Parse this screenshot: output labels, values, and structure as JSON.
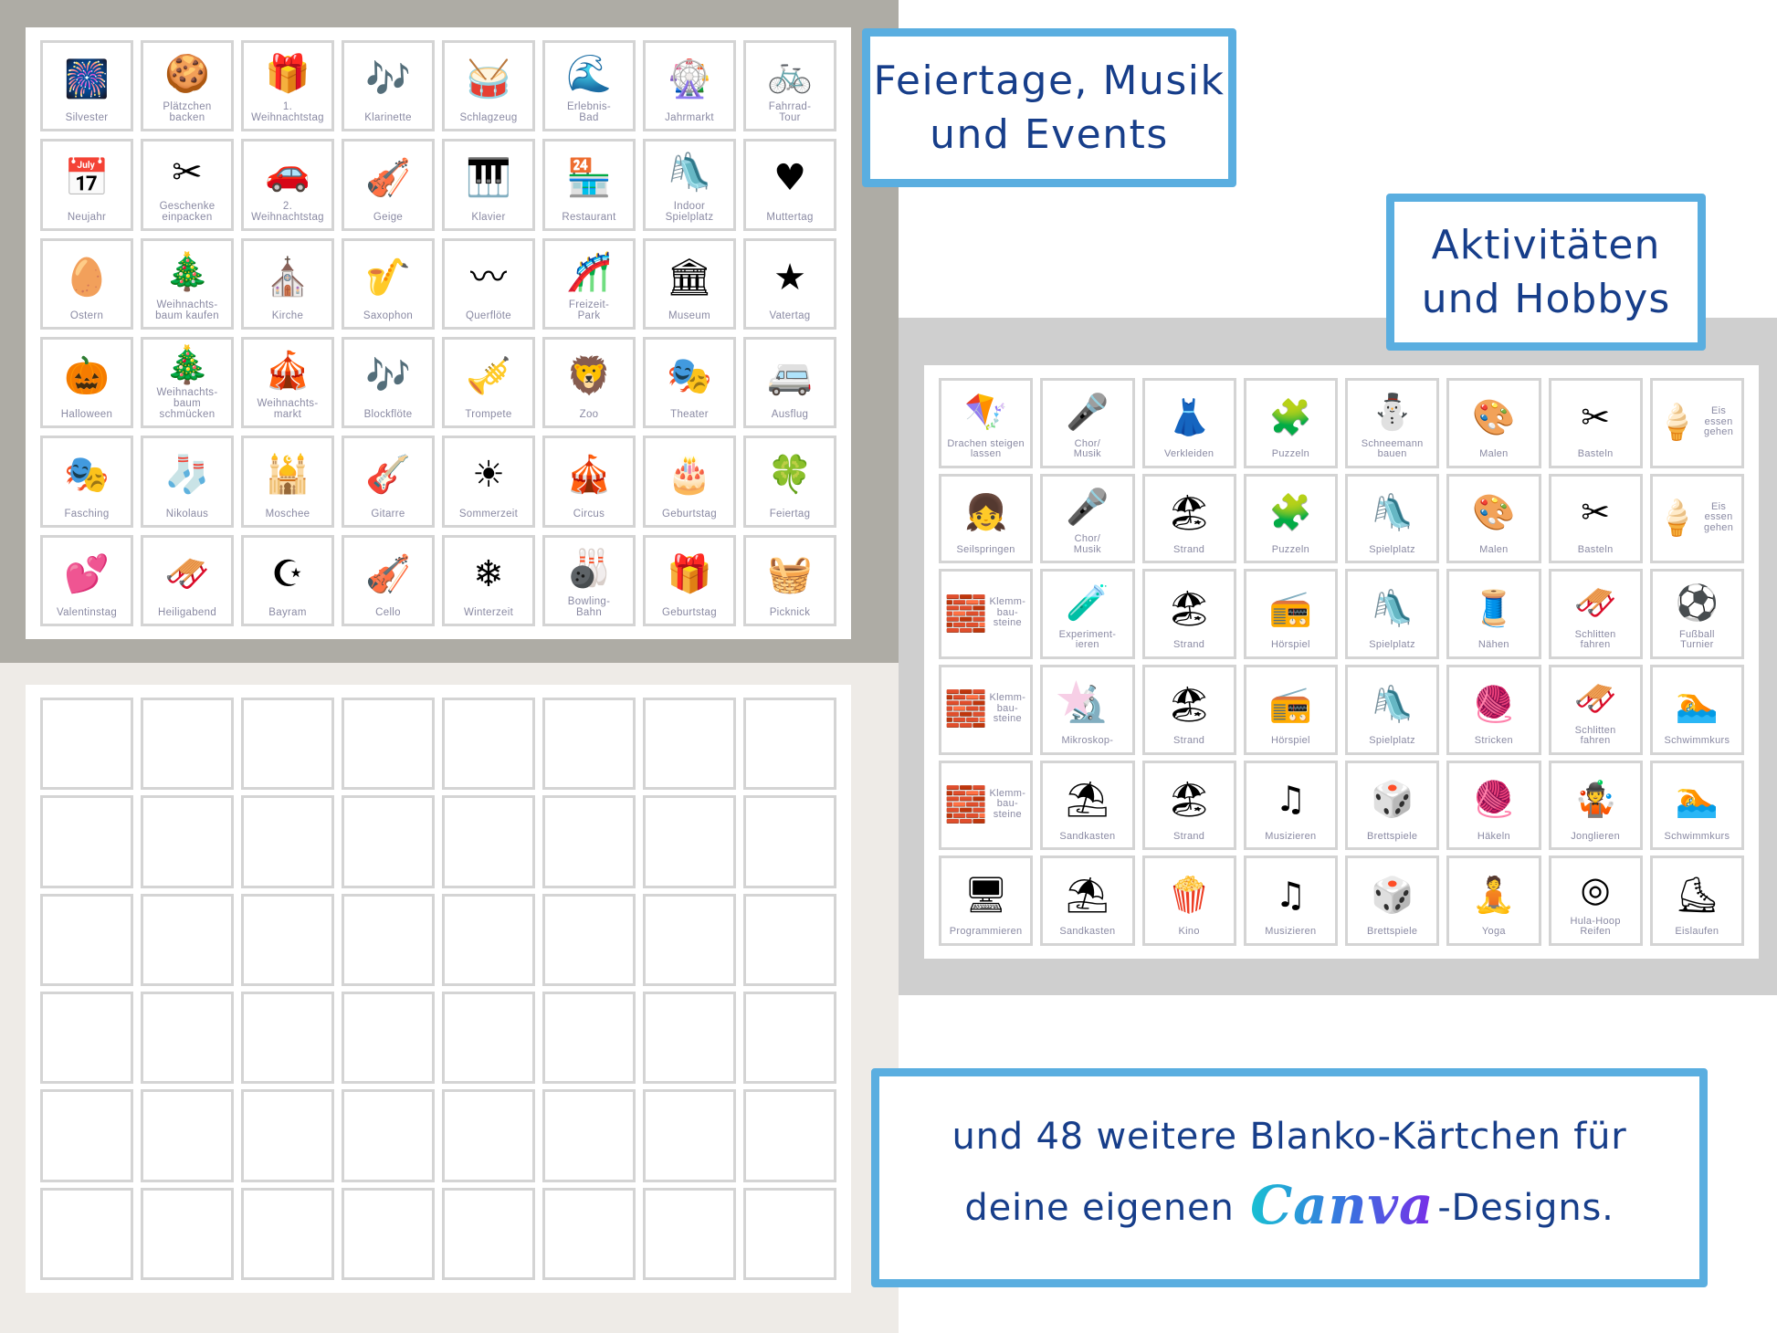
{
  "headings": {
    "events": "Feiertage, Musik\nund Events",
    "activities": "Aktivitäten\nund Hobbys",
    "blank_line1": "und 48 weitere Blanko-Kärtchen für",
    "blank_line2_pre": "deine eigenen ",
    "blank_brand": "Canva",
    "blank_line2_post": "-Designs."
  },
  "colors": {
    "frame_blue": "#5aaee0",
    "heading_navy": "#173e8a",
    "label_gray": "#8a8aa3"
  },
  "events_cards": [
    {
      "label": "Silvester",
      "icon": "fireworks",
      "glyph": "🎆"
    },
    {
      "label": "Plätzchen\nbacken",
      "icon": "cookie-dough",
      "glyph": "🍪"
    },
    {
      "label": "1.\nWeihnachtstag",
      "icon": "gifts",
      "glyph": "🎁"
    },
    {
      "label": "Klarinette",
      "icon": "clarinet",
      "glyph": "🎶"
    },
    {
      "label": "Schlagzeug",
      "icon": "drum-kit",
      "glyph": "🥁"
    },
    {
      "label": "Erlebnis-\nBad",
      "icon": "water-slide",
      "glyph": "🌊"
    },
    {
      "label": "Jahrmarkt",
      "icon": "ferris-wheel",
      "glyph": "🎡"
    },
    {
      "label": "Fahrrad-\nTour",
      "icon": "tandem-bike",
      "glyph": "🚲"
    },
    {
      "label": "Neujahr",
      "icon": "calendar",
      "glyph": "📅"
    },
    {
      "label": "Geschenke\neinpacken",
      "icon": "scissors-ribbon",
      "glyph": "✂"
    },
    {
      "label": "2.\nWeihnachtstag",
      "icon": "car-gifts",
      "glyph": "🚗"
    },
    {
      "label": "Geige",
      "icon": "violin",
      "glyph": "🎻"
    },
    {
      "label": "Klavier",
      "icon": "piano",
      "glyph": "🎹"
    },
    {
      "label": "Restaurant",
      "icon": "restaurant",
      "glyph": "🏪"
    },
    {
      "label": "Indoor\nSpielplatz",
      "icon": "playground-slide",
      "glyph": "🛝"
    },
    {
      "label": "Muttertag",
      "icon": "best-mom",
      "glyph": "♥"
    },
    {
      "label": "Ostern",
      "icon": "easter-eggs",
      "glyph": "🥚"
    },
    {
      "label": "Weihnachts-\nbaum kaufen",
      "icon": "christmas-tree",
      "glyph": "🎄"
    },
    {
      "label": "Kirche",
      "icon": "church",
      "glyph": "⛪"
    },
    {
      "label": "Saxophon",
      "icon": "saxophone",
      "glyph": "🎷"
    },
    {
      "label": "Querflöte",
      "icon": "flute",
      "glyph": "〰"
    },
    {
      "label": "Freizeit-\nPark",
      "icon": "roller-coaster",
      "glyph": "🎢"
    },
    {
      "label": "Museum",
      "icon": "museum",
      "glyph": "🏛"
    },
    {
      "label": "Vatertag",
      "icon": "awesome-dad",
      "glyph": "★"
    },
    {
      "label": "Halloween",
      "icon": "pumpkin",
      "glyph": "🎃"
    },
    {
      "label": "Weihnachts-\nbaum\nschmücken",
      "icon": "ornaments",
      "glyph": "🎄"
    },
    {
      "label": "Weihnachts-\nmarkt",
      "icon": "christmas-market",
      "glyph": "🎪"
    },
    {
      "label": "Blockflöte",
      "icon": "recorder",
      "glyph": "🎶"
    },
    {
      "label": "Trompete",
      "icon": "trumpet",
      "glyph": "🎺"
    },
    {
      "label": "Zoo",
      "icon": "zoo",
      "glyph": "🦁"
    },
    {
      "label": "Theater",
      "icon": "stage-curtain",
      "glyph": "🎭"
    },
    {
      "label": "Ausflug",
      "icon": "camper-van",
      "glyph": "🚐"
    },
    {
      "label": "Fasching",
      "icon": "carnival-mask",
      "glyph": "🎭"
    },
    {
      "label": "Nikolaus",
      "icon": "stocking",
      "glyph": "🧦"
    },
    {
      "label": "Moschee",
      "icon": "mosque",
      "glyph": "🕌"
    },
    {
      "label": "Gitarre",
      "icon": "guitar",
      "glyph": "🎸"
    },
    {
      "label": "Sommerzeit",
      "icon": "sun-clock",
      "glyph": "☀"
    },
    {
      "label": "Circus",
      "icon": "circus-tent",
      "glyph": "🎪"
    },
    {
      "label": "Geburtstag",
      "icon": "birthday-cake",
      "glyph": "🎂"
    },
    {
      "label": "Feiertag",
      "icon": "four-leaf-clover",
      "glyph": "🍀"
    },
    {
      "label": "Valentinstag",
      "icon": "love-birds",
      "glyph": "💕"
    },
    {
      "label": "Heiligabend",
      "icon": "santa-sleigh",
      "glyph": "🛷"
    },
    {
      "label": "Bayram",
      "icon": "crescent-mosque",
      "glyph": "☪"
    },
    {
      "label": "Cello",
      "icon": "cello",
      "glyph": "🎻"
    },
    {
      "label": "Winterzeit",
      "icon": "snowflake-clock",
      "glyph": "❄"
    },
    {
      "label": "Bowling-\nBahn",
      "icon": "bowling-pins",
      "glyph": "🎳"
    },
    {
      "label": "Geburtstag",
      "icon": "gift-box",
      "glyph": "🎁"
    },
    {
      "label": "Picknick",
      "icon": "picnic-basket",
      "glyph": "🧺"
    }
  ],
  "activities_cards": [
    {
      "label": "Drachen steigen\nlassen",
      "icon": "kite",
      "glyph": "🪁"
    },
    {
      "label": "Chor/\nMusik",
      "icon": "microphone",
      "glyph": "🎤"
    },
    {
      "label": "Verkleiden",
      "icon": "dress-up",
      "glyph": "👗"
    },
    {
      "label": "Puzzeln",
      "icon": "puzzle",
      "glyph": "🧩"
    },
    {
      "label": "Schneemann\nbauen",
      "icon": "snowman",
      "glyph": "⛄"
    },
    {
      "label": "Malen",
      "icon": "paint-box",
      "glyph": "🎨"
    },
    {
      "label": "Basteln",
      "icon": "scissors-glue",
      "glyph": "✂"
    },
    {
      "label": "Eis\nessen\ngehen",
      "icon": "ice-cream",
      "glyph": "🍦",
      "side": true
    },
    {
      "label": "Seilspringen",
      "icon": "jump-rope",
      "glyph": "👧"
    },
    {
      "label": "Chor/\nMusik",
      "icon": "microphone",
      "glyph": "🎤"
    },
    {
      "label": "Strand",
      "icon": "beach",
      "glyph": "🏖"
    },
    {
      "label": "Puzzeln",
      "icon": "puzzle",
      "glyph": "🧩"
    },
    {
      "label": "Spielplatz",
      "icon": "playhouse",
      "glyph": "🛝"
    },
    {
      "label": "Malen",
      "icon": "paint-box",
      "glyph": "🎨"
    },
    {
      "label": "Basteln",
      "icon": "scissors-glue",
      "glyph": "✂"
    },
    {
      "label": "Eis\nessen\ngehen",
      "icon": "ice-cream",
      "glyph": "🍦",
      "side": true
    },
    {
      "label": "Klemm-\nbau-\nsteine",
      "icon": "building-blocks",
      "glyph": "🧱",
      "side": true
    },
    {
      "label": "Experiment-\nieren",
      "icon": "lab-kids",
      "glyph": "🧪"
    },
    {
      "label": "Strand",
      "icon": "beach",
      "glyph": "🏖"
    },
    {
      "label": "Hörspiel",
      "icon": "radio",
      "glyph": "📻"
    },
    {
      "label": "Spielplatz",
      "icon": "playhouse",
      "glyph": "🛝"
    },
    {
      "label": "Nähen",
      "icon": "sewing-machine",
      "glyph": "🧵"
    },
    {
      "label": "Schlitten\nfahren",
      "icon": "sled-kid",
      "glyph": "🛷"
    },
    {
      "label": "Fußball\nTurnier",
      "icon": "football",
      "glyph": "⚽"
    },
    {
      "label": "Klemm-\nbau-\nsteine",
      "icon": "building-blocks",
      "glyph": "🧱",
      "side": true
    },
    {
      "label": "Mikroskop-",
      "icon": "microscope",
      "glyph": "🔬",
      "star": true
    },
    {
      "label": "Strand",
      "icon": "beach",
      "glyph": "🏖"
    },
    {
      "label": "Hörspiel",
      "icon": "radio",
      "glyph": "📻"
    },
    {
      "label": "Spielplatz",
      "icon": "playhouse",
      "glyph": "🛝"
    },
    {
      "label": "Stricken",
      "icon": "knitting",
      "glyph": "🧶"
    },
    {
      "label": "Schlitten\nfahren",
      "icon": "sled-kid",
      "glyph": "🛷"
    },
    {
      "label": "Schwimmkurs",
      "icon": "swimming-pool",
      "glyph": "🏊"
    },
    {
      "label": "Klemm-\nbau-\nsteine",
      "icon": "building-blocks",
      "glyph": "🧱",
      "side": true
    },
    {
      "label": "Sandkasten",
      "icon": "sandbox",
      "glyph": "⛱"
    },
    {
      "label": "Strand",
      "icon": "beach",
      "glyph": "🏖"
    },
    {
      "label": "Musizieren",
      "icon": "music-notes",
      "glyph": "♫"
    },
    {
      "label": "Brettspiele",
      "icon": "board-game",
      "glyph": "🎲"
    },
    {
      "label": "Häkeln",
      "icon": "yarn-hook",
      "glyph": "🧶"
    },
    {
      "label": "Jonglieren",
      "icon": "juggling-clubs",
      "glyph": "🤹"
    },
    {
      "label": "Schwimmkurs",
      "icon": "swimming-pool",
      "glyph": "🏊"
    },
    {
      "label": "Programmieren",
      "icon": "computer",
      "glyph": "🖥"
    },
    {
      "label": "Sandkasten",
      "icon": "sandbox",
      "glyph": "⛱"
    },
    {
      "label": "Kino",
      "icon": "popcorn",
      "glyph": "🍿"
    },
    {
      "label": "Musizieren",
      "icon": "music-notes",
      "glyph": "♫"
    },
    {
      "label": "Brettspiele",
      "icon": "board-game",
      "glyph": "🎲"
    },
    {
      "label": "Yoga",
      "icon": "yoga",
      "glyph": "🧘"
    },
    {
      "label": "Hula-Hoop\nReifen",
      "icon": "hula-hoops",
      "glyph": "◎"
    },
    {
      "label": "Eislaufen",
      "icon": "ice-skates",
      "glyph": "⛸"
    }
  ],
  "blank_cards_count": 48
}
